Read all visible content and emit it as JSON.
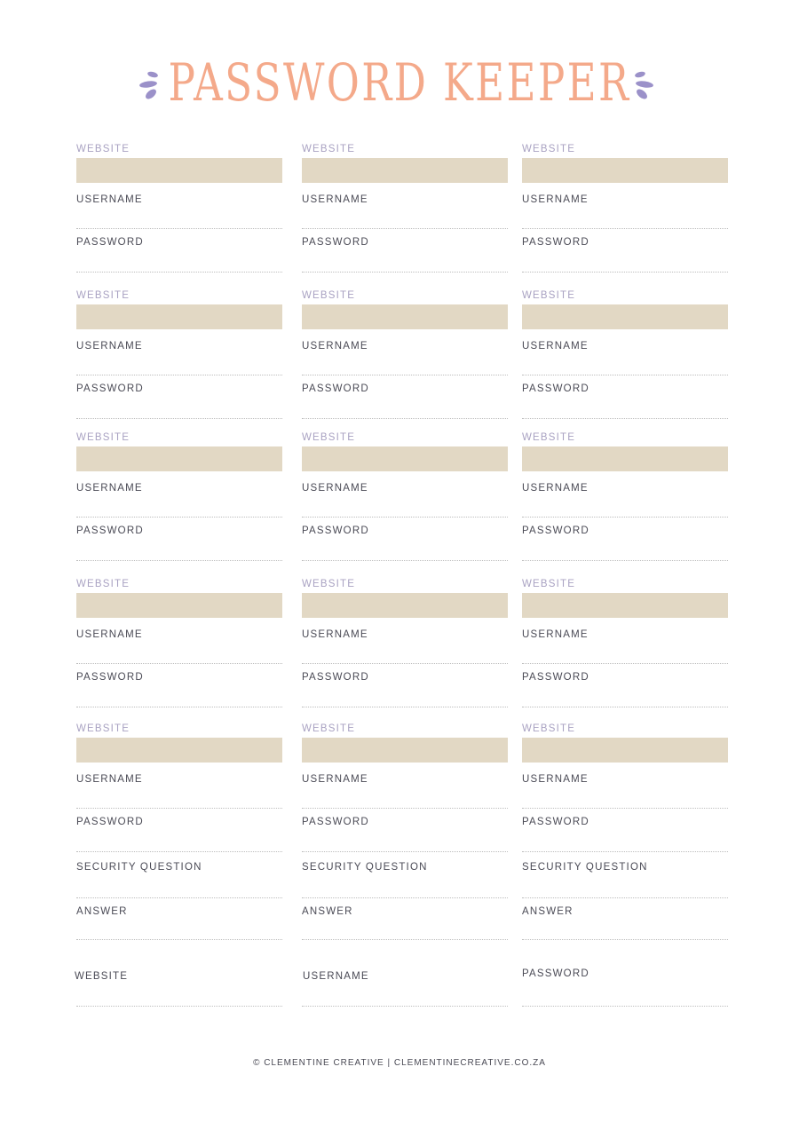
{
  "title": "PASSWORD KEEPER",
  "colors": {
    "title": "#f4a98a",
    "accent": "#9b91c9",
    "field": "#e2d8c4",
    "label": "#4a4a55",
    "website_label": "#a9a2c2"
  },
  "labels": {
    "website": "WEBSITE",
    "username": "USERNAME",
    "password": "PASSWORD",
    "security_question": "SECURITY QUESTION",
    "answer": "ANSWER"
  },
  "bottom_row": {
    "col1": "WEBSITE",
    "col2": "USERNAME",
    "col3": "PASSWORD"
  },
  "footer": "© CLEMENTINE CREATIVE | CLEMENTINECREATIVE.CO.ZA"
}
